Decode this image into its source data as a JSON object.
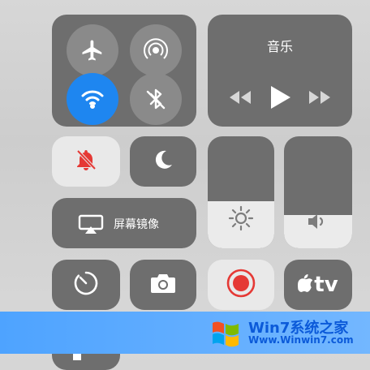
{
  "music": {
    "title": "音乐"
  },
  "airplay": {
    "label": "屏幕镜像"
  },
  "appletv": {
    "label": "tv"
  },
  "watermark": {
    "brand": "Win7系统之家",
    "url": "Www.Winwin7.com"
  },
  "levels": {
    "brightness": 0.42,
    "volume": 0.3
  },
  "colors": {
    "wifi_active": "#1e86f0",
    "record_red": "#e53935",
    "mute_red": "#e53935"
  }
}
